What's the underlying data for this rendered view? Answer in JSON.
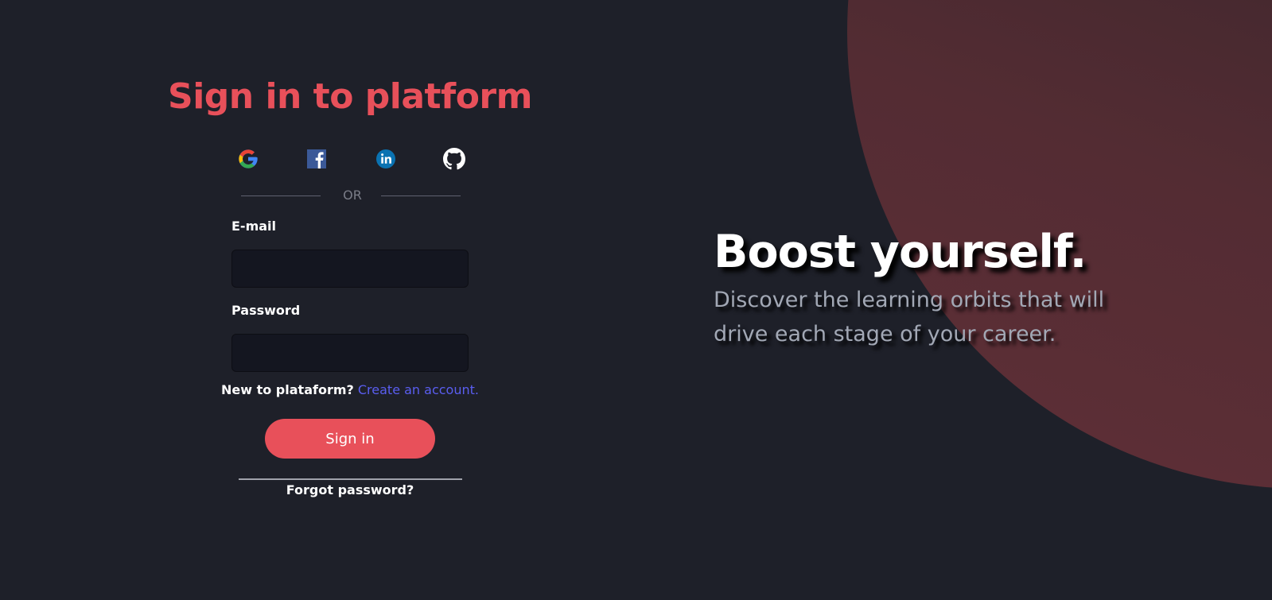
{
  "signin": {
    "title": "Sign in to platform",
    "social": [
      {
        "icon": "google-icon",
        "label": "Google"
      },
      {
        "icon": "facebook-icon",
        "label": "Facebook"
      },
      {
        "icon": "linkedin-icon",
        "label": "LinkedIn"
      },
      {
        "icon": "github-icon",
        "label": "GitHub"
      }
    ],
    "divider_text": "OR",
    "email_label": "E-mail",
    "email_value": "",
    "password_label": "Password",
    "password_value": "",
    "new_question": "New to plataform?",
    "create_link": "Create an account.",
    "signin_button": "Sign in",
    "forgot_password": "Forgot password?"
  },
  "hero": {
    "title": "Boost yourself.",
    "subtitle": "Discover the learning orbits that will drive each stage of your career."
  },
  "colors": {
    "background": "#1e2029",
    "accent": "#e8505a",
    "link": "#5a5ef0",
    "orb": "#602f37",
    "input_bg": "#141620",
    "subtitle": "#a2a8b5"
  }
}
